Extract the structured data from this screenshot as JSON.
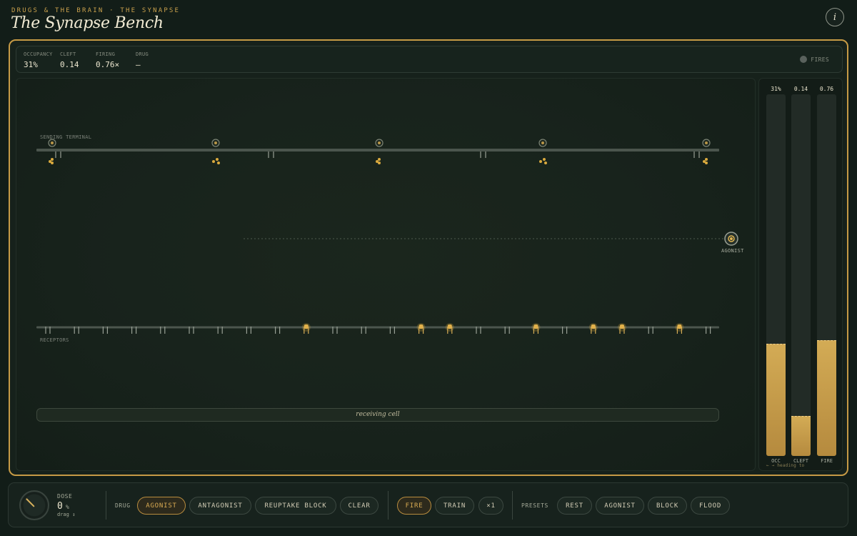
{
  "header": {
    "kicker": "DRUGS & THE BRAIN · THE SYNAPSE",
    "title": "The Synapse Bench",
    "info_icon": "info-icon"
  },
  "readout": {
    "occupancy": {
      "label": "OCCUPANCY",
      "value": "31%"
    },
    "cleft": {
      "label": "CLEFT",
      "value": "0.14"
    },
    "firing": {
      "label": "FIRING",
      "value": "0.76×"
    },
    "drug": {
      "label": "DRUG",
      "value": "—"
    },
    "fires_label": "FIRES"
  },
  "synapse": {
    "sending_label": "SENDING TERMINAL",
    "receptors_label": "RECEPTORS",
    "agonist_label": "AGONIST",
    "receiving_label": "receiving cell",
    "receptor_count": 24,
    "bound_receptors": [
      9,
      13,
      14,
      17,
      19,
      20,
      22
    ],
    "release_sites": 5
  },
  "meters": {
    "occ": {
      "label": "OCC",
      "display": "31%",
      "level": 0.31
    },
    "cleft": {
      "label": "CLEFT",
      "display": "0.14",
      "level": 0.11
    },
    "fire": {
      "label": "FIRE",
      "display": "0.76",
      "level": 0.32
    },
    "note": "← → heading to"
  },
  "controls": {
    "dose": {
      "label": "DOSE",
      "value": "0",
      "unit": "%",
      "hint": "drag ↕"
    },
    "drug_label": "DRUG",
    "drug_buttons": [
      "AGONIST",
      "ANTAGONIST",
      "REUPTAKE BLOCK",
      "CLEAR"
    ],
    "fire_buttons": [
      "FIRE",
      "TRAIN",
      "×1"
    ],
    "presets_label": "PRESETS",
    "preset_buttons": [
      "REST",
      "AGONIST",
      "BLOCK",
      "FLOOD"
    ],
    "colors": {
      "accent": "#c69a45",
      "active_text": "#d8aa52"
    }
  }
}
